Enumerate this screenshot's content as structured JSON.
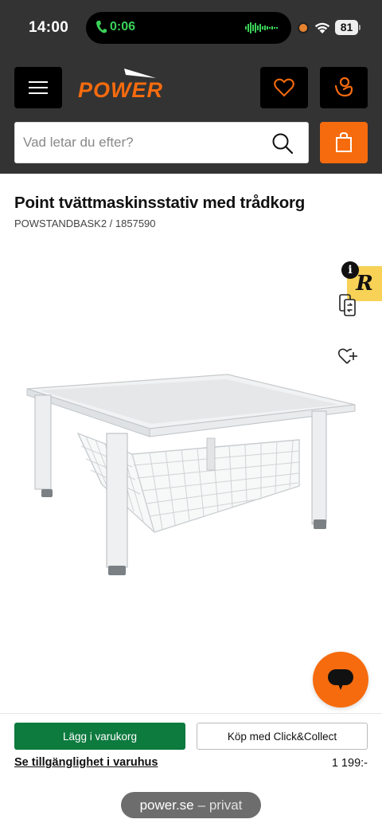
{
  "status_bar": {
    "time": "14:00",
    "call_timer": "0:06",
    "battery": "81"
  },
  "header": {
    "brand": "POWER",
    "search": {
      "placeholder": "Vad letar du efter?"
    },
    "icons": {
      "menu": "hamburger-menu-icon",
      "wishlist": "heart-icon",
      "account": "user-icon",
      "search": "magnifier-icon",
      "cart": "shopping-bag-icon"
    }
  },
  "product": {
    "title": "Point tvättmaskinsstativ med trådkorg",
    "sku": "POWSTANDBASK2 / 1857590",
    "badge_letter": "R",
    "info_letter": "i"
  },
  "purchase": {
    "add_to_cart": "Lägg i varukorg",
    "click_collect": "Köp med Click&Collect",
    "availability_link": "Se tillgänglighet i varuhus",
    "price": "1 199:-"
  },
  "browser": {
    "host": "power.se",
    "mode": "– privat"
  },
  "colors": {
    "header_bg": "#333333",
    "brand_orange": "#f66b0e",
    "primary_green": "#0d7a3e",
    "badge_yellow": "#f7d257"
  }
}
